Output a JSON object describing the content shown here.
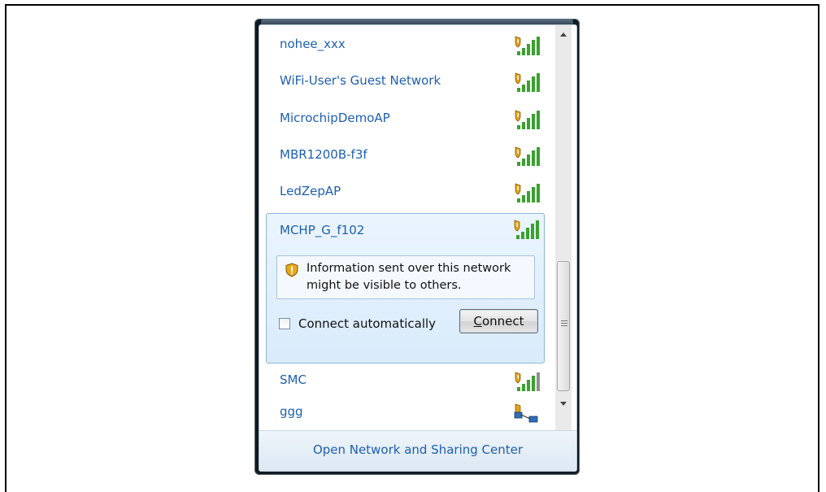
{
  "networks": [
    {
      "name": "nohee_xxx",
      "icon": "secured-wifi-signal-icon"
    },
    {
      "name": "WiFi-User's Guest Network",
      "icon": "secured-wifi-signal-icon"
    },
    {
      "name": "MicrochipDemoAP",
      "icon": "secured-wifi-signal-icon"
    },
    {
      "name": "MBR1200B-f3f",
      "icon": "secured-wifi-signal-icon"
    },
    {
      "name": "LedZepAP",
      "icon": "secured-wifi-signal-icon"
    }
  ],
  "selected_network": {
    "name": "MCHP_G_f102",
    "icon": "secured-wifi-signal-icon",
    "warning": "Information sent over this network might be visible to others.",
    "connect_automatically_label": "Connect automatically",
    "connect_automatically_checked": false,
    "connect_button": {
      "accel": "C",
      "rest": "onnect"
    }
  },
  "networks_below": [
    {
      "name": "SMC",
      "icon": "secured-wifi-signal-icon"
    },
    {
      "name": "ggg",
      "icon": "adhoc-network-icon"
    }
  ],
  "footer": {
    "link": "Open Network and Sharing Center"
  },
  "colors": {
    "link": "#1e5fb0",
    "signal": "#3aa12f",
    "shield": "#e0a21a"
  }
}
